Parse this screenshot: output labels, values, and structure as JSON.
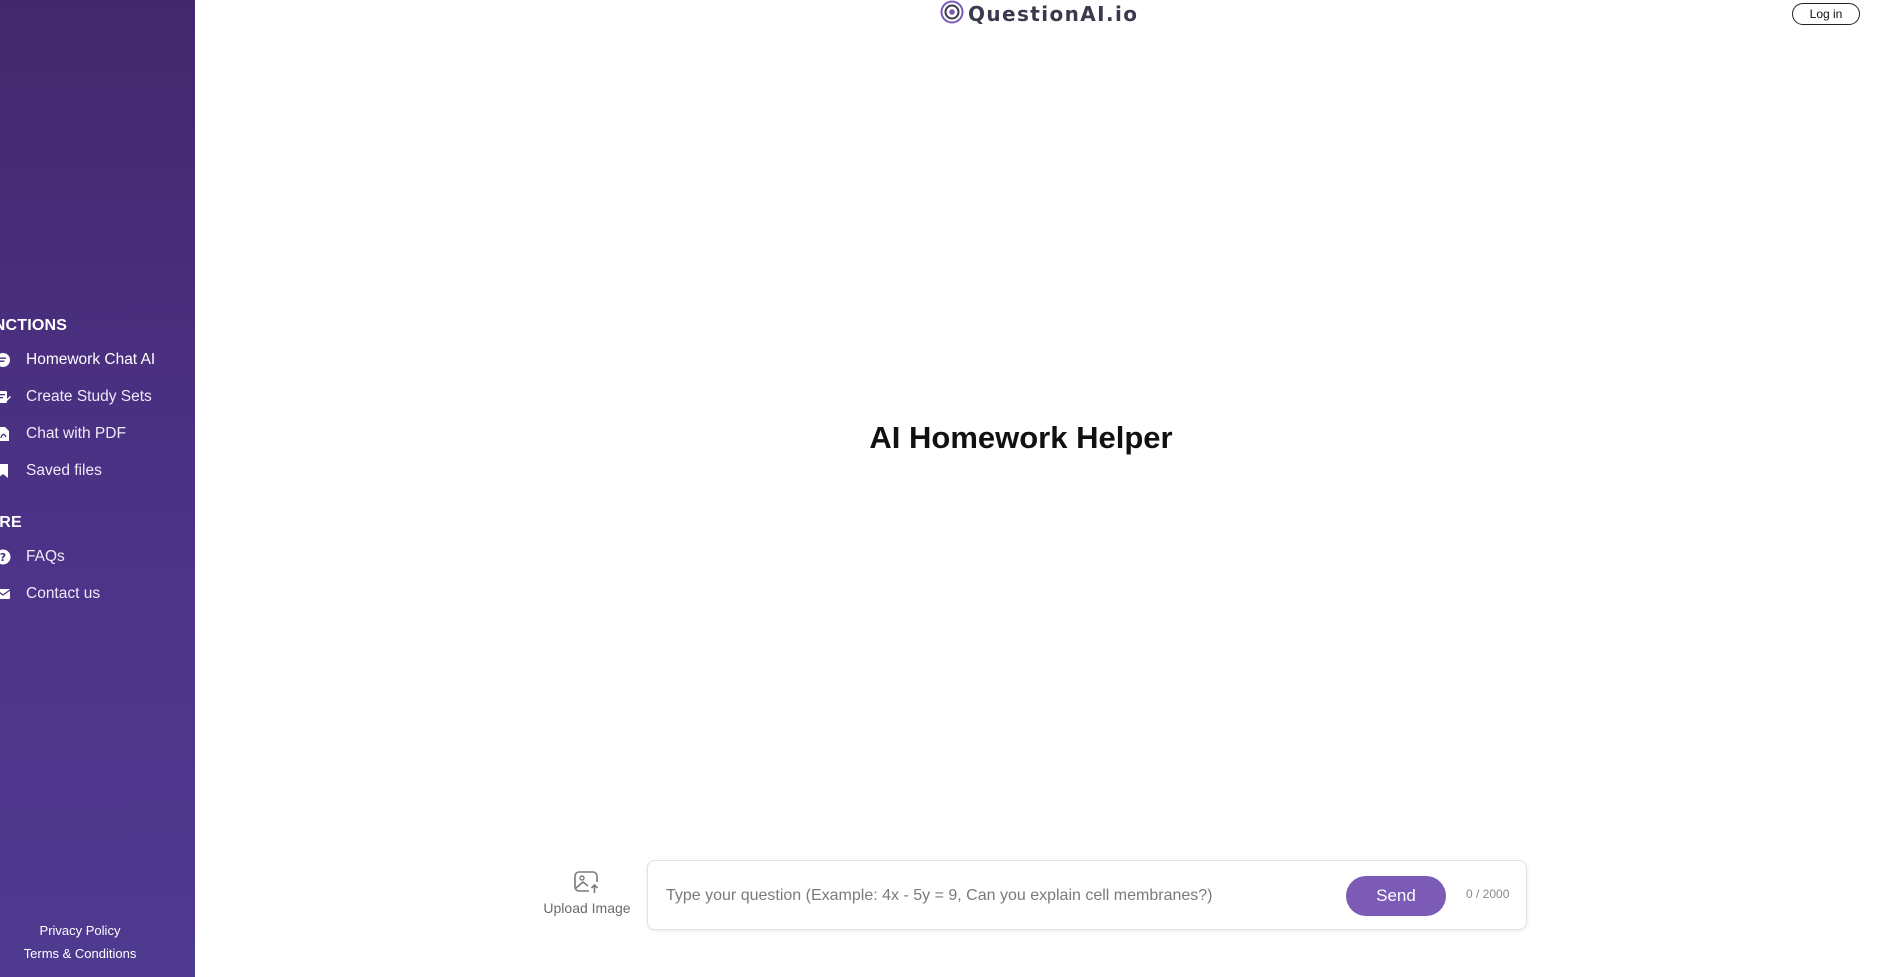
{
  "brand": {
    "name": "QuestionAI.io",
    "icon": "target-logo-icon",
    "color": "#7b5bb5"
  },
  "header": {
    "login_label": "Log in"
  },
  "sidebar": {
    "sections": [
      {
        "title": "UNCTIONS",
        "items": [
          {
            "label": "Homework Chat AI",
            "icon": "chat-bubble-icon",
            "active": true
          },
          {
            "label": "Create Study Sets",
            "icon": "study-sets-icon",
            "active": false
          },
          {
            "label": "Chat with PDF",
            "icon": "pdf-file-icon",
            "active": false
          },
          {
            "label": "Saved files",
            "icon": "bookmark-icon",
            "active": false
          }
        ]
      },
      {
        "title": "IORE",
        "items": [
          {
            "label": "FAQs",
            "icon": "question-circle-icon",
            "active": false
          },
          {
            "label": "Contact us",
            "icon": "envelope-icon",
            "active": false
          }
        ]
      }
    ],
    "footer": {
      "privacy_label": "Privacy Policy",
      "terms_label": "Terms & Conditions"
    },
    "colors": {
      "background_top": "#42286b",
      "background_bottom": "#4e3a8f"
    }
  },
  "main": {
    "title": "AI Homework Helper"
  },
  "composer": {
    "upload_label": "Upload Image",
    "placeholder": "Type your question (Example: 4x - 5y = 9, Can you explain cell membranes?)",
    "value": "",
    "send_label": "Send",
    "counter": "0 / 2000"
  }
}
